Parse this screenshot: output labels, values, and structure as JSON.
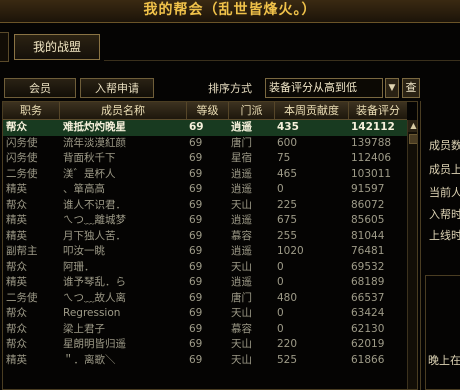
{
  "window": {
    "title": "我的帮会（乱世皆烽火。）"
  },
  "tabs": [
    {
      "label": "我的战盟",
      "active": true
    }
  ],
  "controls": {
    "members_button": "会员",
    "join_requests_button": "入帮申请",
    "sort_label": "排序方式",
    "sort_value": "装备评分从高到低",
    "sort_dropdown_icon": "chevron-down-icon",
    "view_button": "查"
  },
  "table": {
    "columns": [
      "职务",
      "成员名称",
      "等级",
      "门派",
      "本周贡献度",
      "装备评分"
    ],
    "rows": [
      {
        "role": "帮众",
        "name": "难抵灼灼晚星",
        "level": "69",
        "school": "逍遥",
        "contribution": "435",
        "score": "142112",
        "selected": true
      },
      {
        "role": "闪务使",
        "name": "流年淡漠紅颜",
        "level": "69",
        "school": "唐门",
        "contribution": "600",
        "score": "139788"
      },
      {
        "role": "闪务使",
        "name": "背面秋千下",
        "level": "69",
        "school": "星宿",
        "contribution": "75",
        "score": "112406"
      },
      {
        "role": "二务使",
        "name": "渼゛是杯人",
        "level": "69",
        "school": "逍遥",
        "contribution": "465",
        "score": "103011"
      },
      {
        "role": "精英",
        "name": "、箪高高",
        "level": "69",
        "school": "逍遥",
        "contribution": "0",
        "score": "91597"
      },
      {
        "role": "帮众",
        "name": "谁人不识君．",
        "level": "69",
        "school": "天山",
        "contribution": "225",
        "score": "86072"
      },
      {
        "role": "精英",
        "name": "ㄟつ﹏離城梦",
        "level": "69",
        "school": "逍遥",
        "contribution": "675",
        "score": "85605"
      },
      {
        "role": "精英",
        "name": "月下独人苦．",
        "level": "69",
        "school": "慕容",
        "contribution": "255",
        "score": "81044"
      },
      {
        "role": "副帮主",
        "name": "叩汝一眺",
        "level": "69",
        "school": "逍遥",
        "contribution": "1020",
        "score": "76481"
      },
      {
        "role": "帮众",
        "name": "阿珊．",
        "level": "69",
        "school": "天山",
        "contribution": "0",
        "score": "69532"
      },
      {
        "role": "精英",
        "name": "谁予琴乱．ら",
        "level": "69",
        "school": "逍遥",
        "contribution": "0",
        "score": "68189"
      },
      {
        "role": "二务使",
        "name": "ㄟつ﹏故人离",
        "level": "69",
        "school": "唐门",
        "contribution": "480",
        "score": "66537"
      },
      {
        "role": "帮众",
        "name": "Regression",
        "level": "69",
        "school": "天山",
        "contribution": "0",
        "score": "63424"
      },
      {
        "role": "帮众",
        "name": "梁上君子",
        "level": "69",
        "school": "慕容",
        "contribution": "0",
        "score": "62130"
      },
      {
        "role": "帮众",
        "name": "星朗明皆归遥",
        "level": "69",
        "school": "天山",
        "contribution": "220",
        "score": "62019"
      },
      {
        "role": "精英",
        "name": "＂．离歌＼",
        "level": "69",
        "school": "天山",
        "contribution": "525",
        "score": "61866"
      }
    ]
  },
  "side_panel": {
    "labels": [
      "成员数",
      "成员上",
      "当前人",
      "入帮时",
      "上线时"
    ],
    "note_partial": "晚上在"
  },
  "scrollbar": {
    "up_icon": "arrow-up-icon",
    "position": 0
  }
}
